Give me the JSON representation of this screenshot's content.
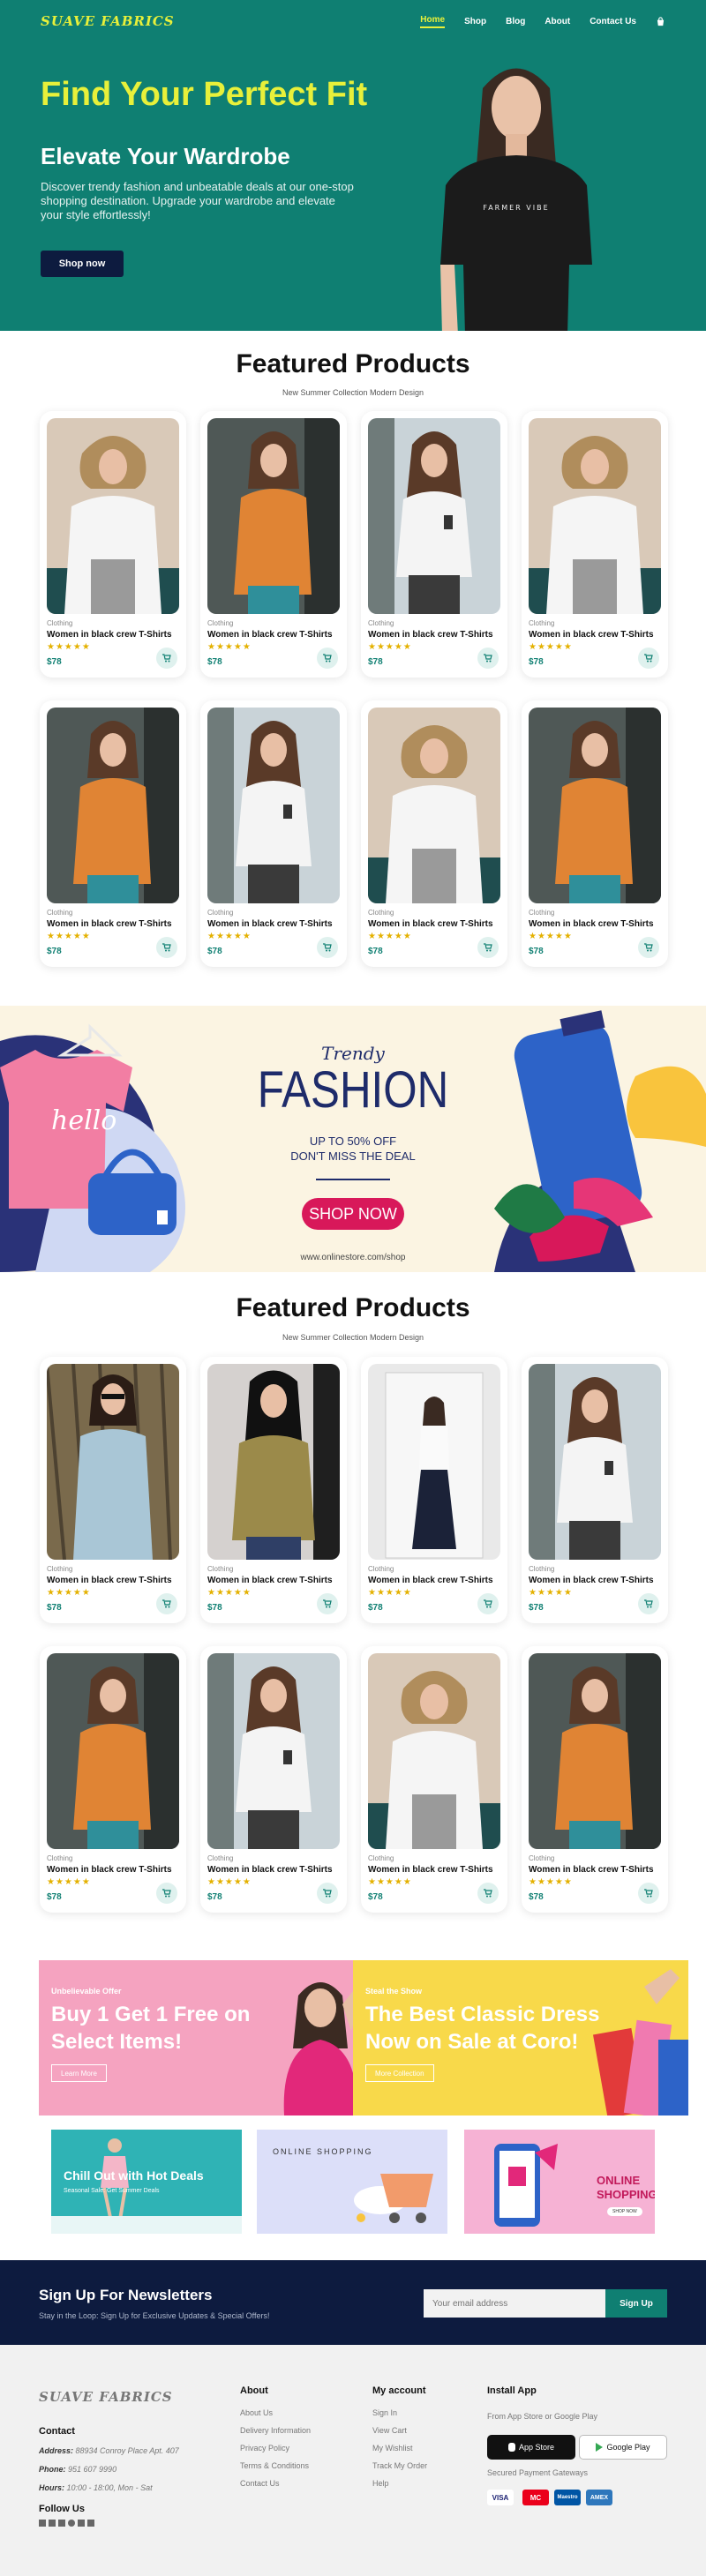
{
  "header": {
    "logo": "SUAVE FABRICS",
    "nav": [
      "Home",
      "Shop",
      "Blog",
      "About",
      "Contact Us"
    ],
    "active_nav": "Home",
    "cart_icon": "bag-icon"
  },
  "hero": {
    "title": "Find Your Perfect Fit",
    "subtitle": "Elevate Your Wardrobe",
    "description": "Discover trendy fashion and unbeatable deals at our one-stop shopping destination. Upgrade your wardrobe and elevate your style effortlessly!",
    "cta": "Shop now",
    "shirt_text": "FARMER VIBE"
  },
  "featured_1": {
    "title": "Featured Products",
    "subtitle": "New Summer Collection Modern Design",
    "products": [
      {
        "category": "Clothing",
        "name": "Women in black crew T-Shirts",
        "price": "$78",
        "rating": 5
      },
      {
        "category": "Clothing",
        "name": "Women in black crew T-Shirts",
        "price": "$78",
        "rating": 5
      },
      {
        "category": "Clothing",
        "name": "Women in black crew T-Shirts",
        "price": "$78",
        "rating": 5
      },
      {
        "category": "Clothing",
        "name": "Women in black crew T-Shirts",
        "price": "$78",
        "rating": 5
      },
      {
        "category": "Clothing",
        "name": "Women in black crew T-Shirts",
        "price": "$78",
        "rating": 5
      },
      {
        "category": "Clothing",
        "name": "Women in black crew T-Shirts",
        "price": "$78",
        "rating": 5
      },
      {
        "category": "Clothing",
        "name": "Women in black crew T-Shirts",
        "price": "$78",
        "rating": 5
      },
      {
        "category": "Clothing",
        "name": "Women in black crew T-Shirts",
        "price": "$78",
        "rating": 5
      }
    ]
  },
  "banner": {
    "kicker": "Trendy",
    "title": "FASHION",
    "line1": "UP TO 50% OFF",
    "line2": "DON'T MISS THE DEAL",
    "cta": "SHOP NOW",
    "url": "www.onlinestore.com/shop",
    "shirt_text": "hello"
  },
  "featured_2": {
    "title": "Featured Products",
    "subtitle": "New Summer Collection Modern Design",
    "products": [
      {
        "category": "Clothing",
        "name": "Women in black crew T-Shirts",
        "price": "$78",
        "rating": 5
      },
      {
        "category": "Clothing",
        "name": "Women in black crew T-Shirts",
        "price": "$78",
        "rating": 5
      },
      {
        "category": "Clothing",
        "name": "Women in black crew T-Shirts",
        "price": "$78",
        "rating": 5
      },
      {
        "category": "Clothing",
        "name": "Women in black crew T-Shirts",
        "price": "$78",
        "rating": 5
      },
      {
        "category": "Clothing",
        "name": "Women in black crew T-Shirts",
        "price": "$78",
        "rating": 5
      },
      {
        "category": "Clothing",
        "name": "Women in black crew T-Shirts",
        "price": "$78",
        "rating": 5
      },
      {
        "category": "Clothing",
        "name": "Women in black crew T-Shirts",
        "price": "$78",
        "rating": 5
      },
      {
        "category": "Clothing",
        "name": "Women in black crew T-Shirts",
        "price": "$78",
        "rating": 5
      }
    ]
  },
  "offers": [
    {
      "tag": "Unbelievable Offer",
      "heading": "Buy 1 Get 1 Free on Select Items!",
      "button": "Learn More"
    },
    {
      "tag": "Steal the Show",
      "heading": "The Best Classic Dress Now on Sale at Coro!",
      "button": "More Collection"
    }
  ],
  "mini_banners": [
    {
      "heading": "Chill Out with Hot Deals",
      "sub": "Seasonal Sale: Get Summer Deals"
    },
    {
      "heading": "ONLINE SHOPPING"
    },
    {
      "heading": "ONLINE SHOPPING",
      "button": "SHOP NOW"
    }
  ],
  "newsletter": {
    "title": "Sign Up For Newsletters",
    "text": "Stay in the Loop: Sign Up for Exclusive Updates & Special Offers!",
    "placeholder": "Your email address",
    "button": "Sign Up"
  },
  "footer": {
    "logo": "SUAVE FABRICS",
    "contact_heading": "Contact",
    "address_label": "Address:",
    "address": "88934 Conroy Place Apt. 407",
    "phone_label": "Phone:",
    "phone": "951 607 9990",
    "hours_label": "Hours:",
    "hours": "10:00 - 18:00, Mon - Sat",
    "follow_heading": "Follow Us",
    "about_heading": "About",
    "about_links": [
      "About Us",
      "Delivery Information",
      "Privacy Policy",
      "Terms & Conditions",
      "Contact Us"
    ],
    "account_heading": "My account",
    "account_links": [
      "Sign In",
      "View Cart",
      "My Wishlist",
      "Track My Order",
      "Help"
    ],
    "install_heading": "Install App",
    "install_text": "From App Store or Google Play",
    "app_store": "App Store",
    "google_play": "Google Play",
    "payment_text": "Secured Payment Gateways",
    "payments": [
      "VISA",
      "MC",
      "Maestro",
      "AMEX"
    ]
  },
  "colors": {
    "primary": "#0f7f72",
    "accent_yellow": "#e8f03a",
    "navy": "#0d1b3f",
    "star": "#e4b100"
  }
}
